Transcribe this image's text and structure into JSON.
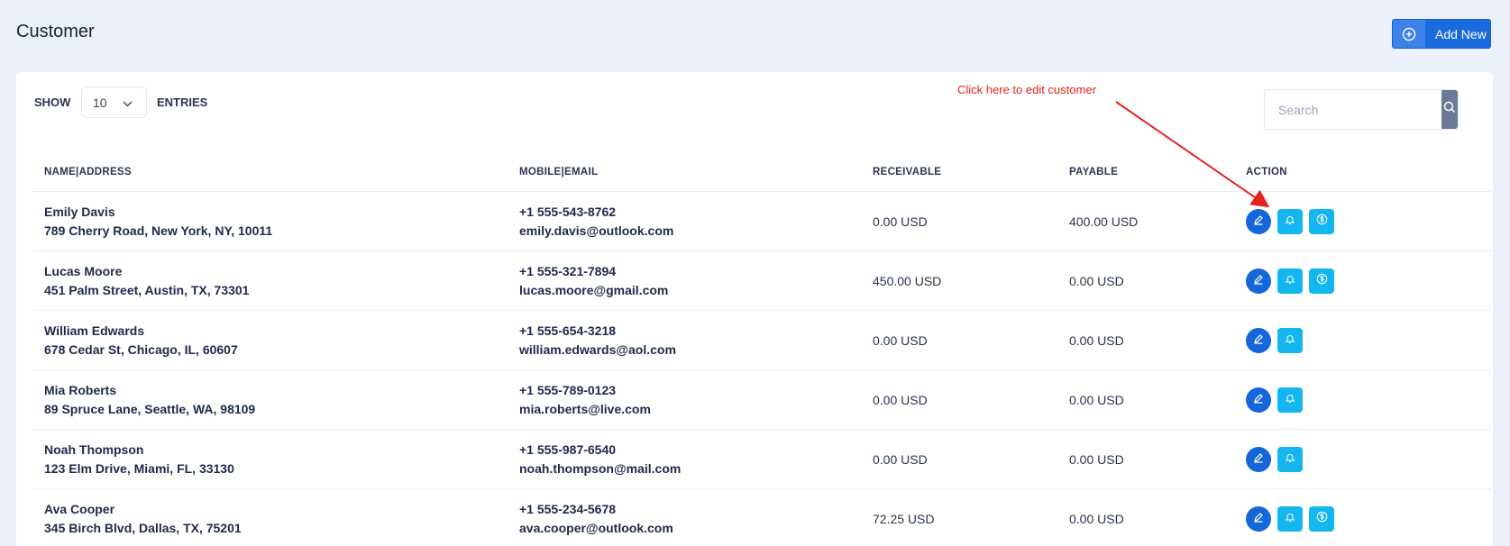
{
  "page": {
    "title": "Customer",
    "add_new_label": "Add New"
  },
  "controls": {
    "show_label": "SHOW",
    "entries_value": "10",
    "entries_label": "ENTRIES",
    "search_placeholder": "Search"
  },
  "annotation": {
    "text": "Click here to edit customer",
    "color": "#e8201c"
  },
  "table": {
    "headers": [
      "NAME|ADDRESS",
      "MOBILE|EMAIL",
      "RECEIVABLE",
      "PAYABLE",
      "ACTION"
    ],
    "rows": [
      {
        "name": "Emily Davis",
        "address": "789 Cherry Road, New York, NY, 10011",
        "mobile": "+1 555-543-8762",
        "email": "emily.davis@outlook.com",
        "receivable": "0.00 USD",
        "payable": "400.00 USD"
      },
      {
        "name": "Lucas Moore",
        "address": "451 Palm Street, Austin, TX, 73301",
        "mobile": "+1 555-321-7894",
        "email": "lucas.moore@gmail.com",
        "receivable": "450.00 USD",
        "payable": "0.00 USD"
      },
      {
        "name": "William Edwards",
        "address": "678 Cedar St, Chicago, IL, 60607",
        "mobile": "+1 555-654-3218",
        "email": "william.edwards@aol.com",
        "receivable": "0.00 USD",
        "payable": "0.00 USD"
      },
      {
        "name": "Mia Roberts",
        "address": "89 Spruce Lane, Seattle, WA, 98109",
        "mobile": "+1 555-789-0123",
        "email": "mia.roberts@live.com",
        "receivable": "0.00 USD",
        "payable": "0.00 USD"
      },
      {
        "name": "Noah Thompson",
        "address": "123 Elm Drive, Miami, FL, 33130",
        "mobile": "+1 555-987-6540",
        "email": "noah.thompson@mail.com",
        "receivable": "0.00 USD",
        "payable": "0.00 USD"
      },
      {
        "name": "Ava Cooper",
        "address": "345 Birch Blvd, Dallas, TX, 75201",
        "mobile": "+1 555-234-5678",
        "email": "ava.cooper@outlook.com",
        "receivable": "72.25 USD",
        "payable": "0.00 USD"
      }
    ]
  },
  "colors": {
    "primary": "#1466da",
    "info": "#14b6f0",
    "background": "#ecf0fa"
  }
}
